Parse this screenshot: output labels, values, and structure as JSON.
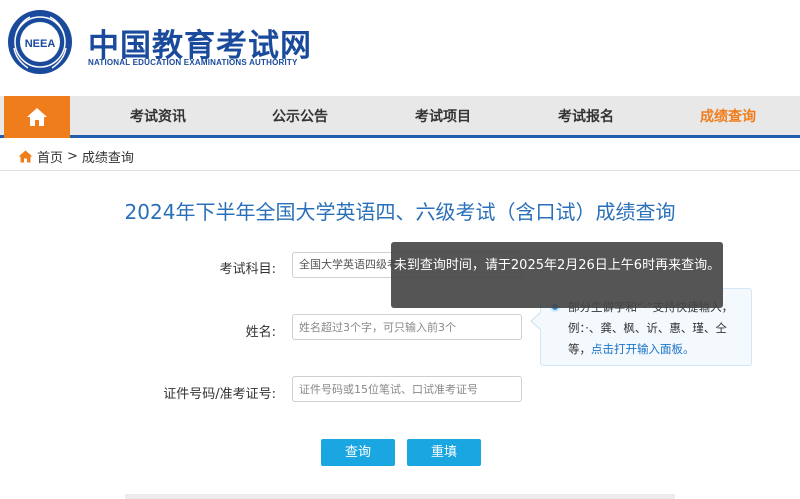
{
  "header": {
    "logo_text": "NEEA",
    "title_cn": "中国教育考试网",
    "title_en": "NATIONAL EDUCATION EXAMINATIONS AUTHORITY"
  },
  "nav": {
    "items": [
      "考试资讯",
      "公示公告",
      "考试项目",
      "考试报名",
      "成绩查询"
    ],
    "active_index": 4
  },
  "breadcrumb": {
    "home": "首页",
    "separator": ">",
    "current": "成绩查询"
  },
  "page_title": "2024年下半年全国大学英语四、六级考试（含口试）成绩查询",
  "form": {
    "subject_label": "考试科目:",
    "subject_value": "全国大学英语四级考试",
    "name_label": "姓名:",
    "name_placeholder": "姓名超过3个字，可只输入前3个",
    "id_label": "证件号码/准考证号:",
    "id_placeholder": "证件号码或15位笔试、口试准考证号",
    "query_button": "查询",
    "reset_button": "重填"
  },
  "hint": {
    "text": "部分生僻字和“·”支持快捷输入，例：·、龚、枫、䜣、惠、瑾、仝等，",
    "link": "点击打开输入面板。"
  },
  "toast": {
    "message": "未到查询时间，请于2025年2月26日上午6时再来查询。"
  },
  "colors": {
    "brand_blue": "#1a4a9c",
    "nav_orange": "#f07d1b",
    "button_blue": "#1aa6e0",
    "title_blue": "#2a70b8"
  }
}
